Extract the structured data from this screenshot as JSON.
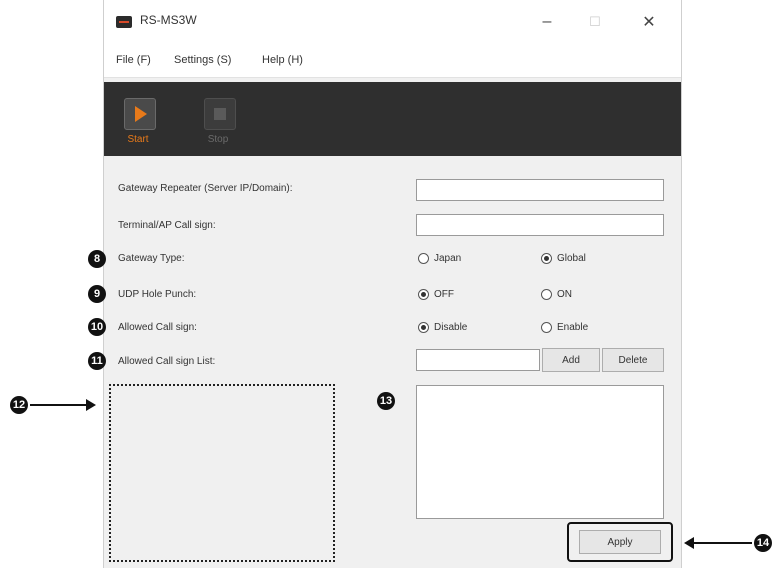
{
  "window": {
    "title": "RS-MS3W",
    "minimize": "–",
    "maximize": "☐",
    "close": "✕"
  },
  "menu": {
    "file": "File (F)",
    "settings": "Settings (S)",
    "help": "Help (H)"
  },
  "toolbar": {
    "start": "Start",
    "stop": "Stop"
  },
  "form": {
    "gateway_repeater": {
      "label": "Gateway Repeater (Server IP/Domain):",
      "value": ""
    },
    "terminal_callsign": {
      "label": "Terminal/AP Call sign:",
      "value": ""
    },
    "gateway_type": {
      "label": "Gateway Type:",
      "opt1": "Japan",
      "opt2": "Global",
      "selected": "Global"
    },
    "udp_hole_punch": {
      "label": "UDP Hole Punch:",
      "opt1": "OFF",
      "opt2": "ON",
      "selected": "OFF"
    },
    "allowed_callsign": {
      "label": "Allowed Call sign:",
      "opt1": "Disable",
      "opt2": "Enable",
      "selected": "Disable"
    },
    "allowed_list": {
      "label": "Allowed Call sign List:",
      "value": "",
      "add": "Add",
      "delete": "Delete"
    },
    "apply": "Apply"
  },
  "callouts": {
    "c8": "8",
    "c9": "9",
    "c10": "10",
    "c11": "11",
    "c12": "12",
    "c13": "13",
    "c14": "14"
  }
}
